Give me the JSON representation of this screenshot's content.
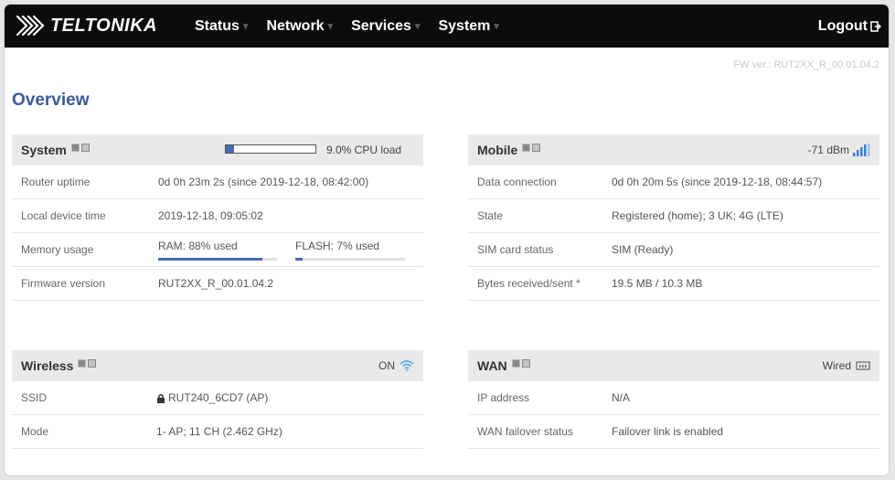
{
  "brand": "TELTONIKA",
  "menu": [
    {
      "label": "Status"
    },
    {
      "label": "Network"
    },
    {
      "label": "Services"
    },
    {
      "label": "System"
    }
  ],
  "logout_label": "Logout",
  "fw_version": "FW ver.: RUT2XX_R_00.01.04.2",
  "page_title": "Overview",
  "system": {
    "title": "System",
    "cpu_load_label": "9.0% CPU load",
    "cpu_load_fraction": 0.09,
    "rows": {
      "uptime": {
        "key": "Router uptime",
        "value": "0d 0h 23m 2s (since 2019-12-18, 08:42:00)"
      },
      "time": {
        "key": "Local device time",
        "value": "2019-12-18, 09:05:02"
      },
      "memory": {
        "key": "Memory usage",
        "ram_label": "RAM: 88% used",
        "ram_fraction": 0.88,
        "flash_label": "FLASH: 7% used",
        "flash_fraction": 0.07
      },
      "firmware": {
        "key": "Firmware version",
        "value": "RUT2XX_R_00.01.04.2"
      }
    }
  },
  "mobile": {
    "title": "Mobile",
    "signal": "-71 dBm",
    "rows": [
      {
        "key": "Data connection",
        "value": "0d 0h 20m 5s (since 2019-12-18, 08:44:57)"
      },
      {
        "key": "State",
        "value": "Registered (home); 3 UK; 4G (LTE)"
      },
      {
        "key": "SIM card status",
        "value": "SIM (Ready)"
      },
      {
        "key": "Bytes received/sent *",
        "value": "19.5 MB / 10.3 MB"
      }
    ]
  },
  "wireless": {
    "title": "Wireless",
    "status": "ON",
    "rows": {
      "ssid": {
        "key": "SSID",
        "value": "RUT240_6CD7 (AP)"
      },
      "mode": {
        "key": "Mode",
        "value": "1- AP; 11 CH (2.462 GHz)"
      }
    }
  },
  "wan": {
    "title": "WAN",
    "status": "Wired",
    "rows": [
      {
        "key": "IP address",
        "value": "N/A"
      },
      {
        "key": "WAN failover status",
        "value": "Failover link is enabled"
      }
    ]
  },
  "colors": {
    "accent": "#3b5a98",
    "topbar": "#0c0c0c",
    "progress": "#4a6bb3"
  }
}
